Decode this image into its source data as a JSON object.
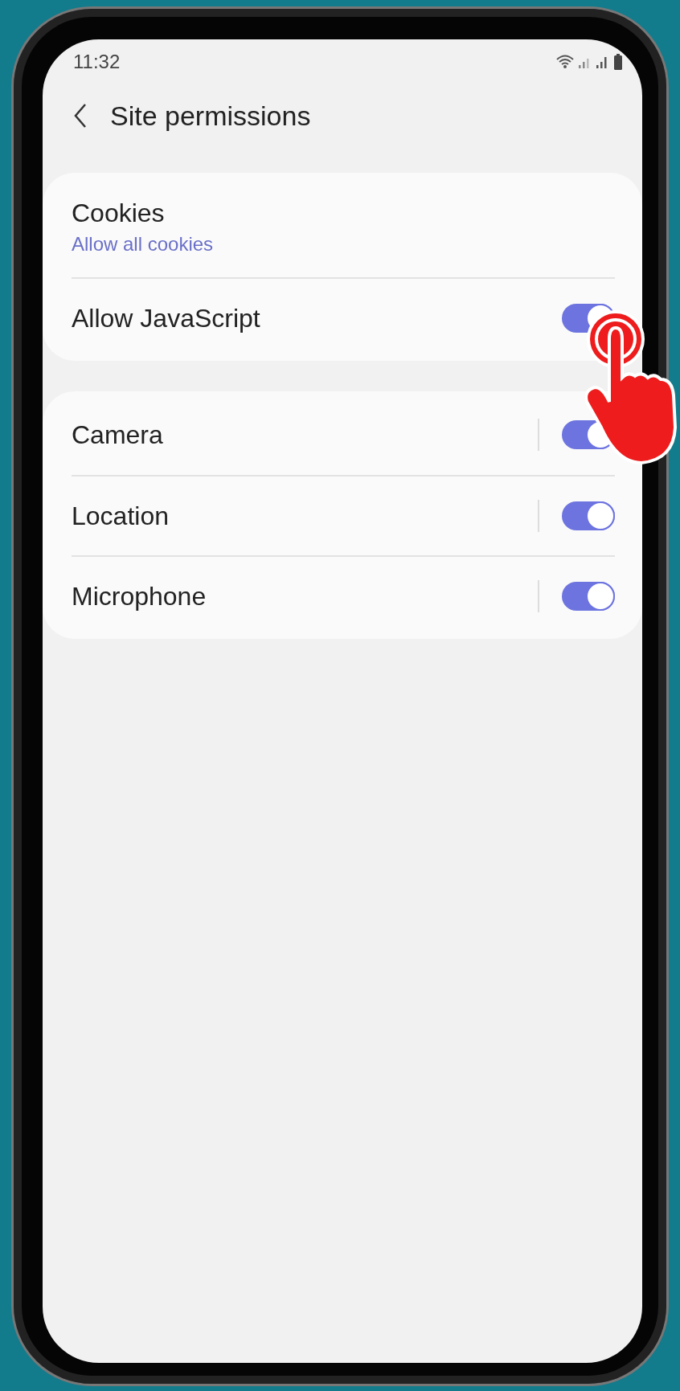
{
  "status_bar": {
    "time": "11:32"
  },
  "header": {
    "title": "Site permissions"
  },
  "groups": [
    {
      "items": [
        {
          "kind": "link",
          "title": "Cookies",
          "subtitle": "Allow all cookies"
        },
        {
          "kind": "switch",
          "title": "Allow JavaScript",
          "on": true
        }
      ]
    },
    {
      "items": [
        {
          "kind": "divided_switch",
          "title": "Camera",
          "on": true
        },
        {
          "kind": "divided_switch",
          "title": "Location",
          "on": true
        },
        {
          "kind": "divided_switch",
          "title": "Microphone",
          "on": true
        }
      ]
    }
  ]
}
